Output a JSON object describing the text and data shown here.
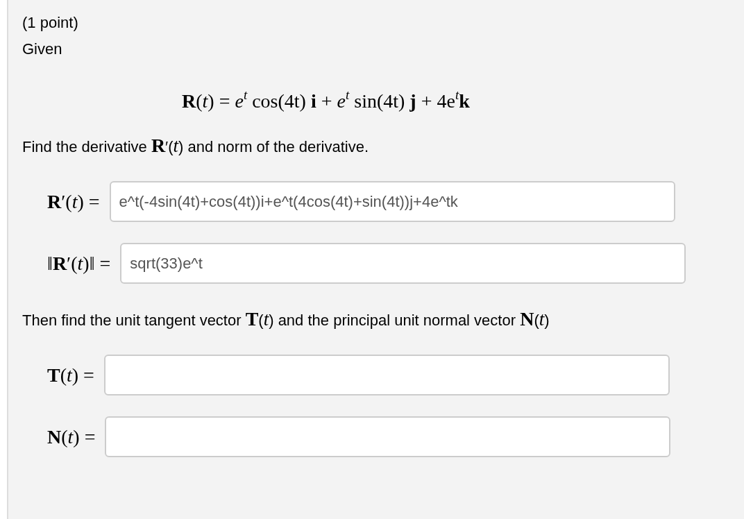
{
  "points": "(1 point)",
  "intro": "Given",
  "formula": "**R**(*t*) = *e*$^{t}$ cos(4t) **i** + *e*$^{t}$ sin(4t) **j** + 4e$^{t}$**k**",
  "sections": [
    {
      "prompt": "Find the derivative **R**′(*t*) and norm of the derivative.",
      "fields": [
        {
          "label": "**R**′(*t*) =",
          "value": "e^t(-4sin(4t)+cos(4t))i+e^t(4cos(4t)+sin(4t))j+4e^tk"
        },
        {
          "label": "‖**R**′(*t*)‖ =",
          "value": "sqrt(33)e^t"
        }
      ]
    },
    {
      "prompt": "Then find the unit tangent vector **T**(*t*) and the principal unit normal vector **N**(*t*)",
      "fields": [
        {
          "label": "**T**(*t*) ="
        },
        {
          "label": "**N**(*t*) ="
        }
      ]
    }
  ]
}
